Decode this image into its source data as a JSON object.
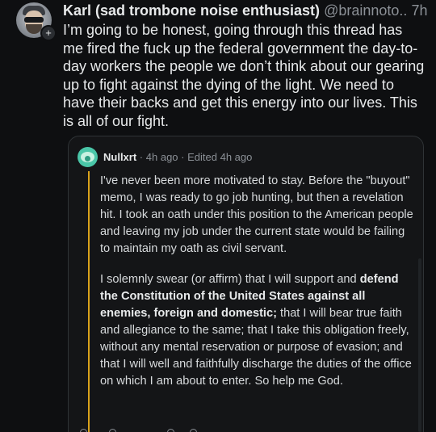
{
  "post": {
    "author_name": "Karl (sad trombone noise enthusiast)",
    "handle": "@brainnoto..",
    "time": "7h",
    "follow_symbol": "+",
    "body": "I’m going to be honest, going through this thread has me fired the fuck up the federal government the day-to-day workers the people we don’t think about our gearing up to fight against the dying of the light. We need to have their backs and get this energy into our lives. This is all of our fight."
  },
  "quote": {
    "author": "Nullxrt",
    "separator": "·",
    "time": "4h ago",
    "edited": "Edited 4h ago",
    "paragraph1": "I've never been more motivated to stay. Before the \"buyout\" memo, I was ready to go job hunting, but then a revelation hit. I took an oath under this position to the American people and leaving my job under the current state would be failing to maintain my oath as civil servant.",
    "paragraph2_intro": "I solemnly swear (or affirm) that I will support and ",
    "paragraph2_bold": "defend the Constitution of the United States against all enemies, foreign and domestic;",
    "paragraph2_rest": " that I will bear true faith and allegiance to the same; that I take this obligation freely, without any mental reservation or purpose of evasion; and that I will well and faithfully discharge the duties of the office on which I am about to enter. So help me God."
  },
  "colors": {
    "background": "#0e0f11",
    "text": "#e7e9ea",
    "muted": "#8b9096",
    "quote_accent": "#d9a21b",
    "quote_avatar": "#4ac6a8"
  },
  "icons": {
    "author_avatar": "avatar-icon",
    "follow": "plus-icon",
    "quote_avatar": "subreddit-avatar-icon"
  }
}
